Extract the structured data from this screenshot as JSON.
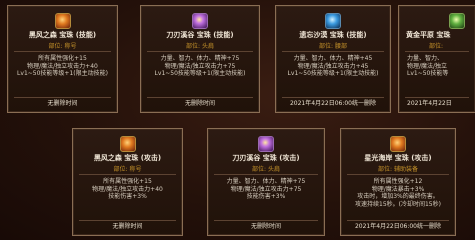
{
  "cards": [
    {
      "name": "黑风之森 宝珠 (技能)",
      "part": "部位: 称号",
      "stats": [
        "所有属性强化+15",
        "物理/魔法/独立攻击力+40",
        "Lv1~50技能等级+1(限主动技能)"
      ],
      "footer": "无删除时间"
    },
    {
      "name": "刀刃溪谷 宝珠 (技能)",
      "part": "部位: 头肩",
      "stats": [
        "力量、智力、体力、精神+75",
        "物理/魔法/独立攻击力+75",
        "Lv1~50技能等级+1(限主动技能)"
      ],
      "footer": "无删除时间"
    },
    {
      "name": "遗忘沙漠 宝珠 (技能)",
      "part": "部位: 腰部",
      "stats": [
        "力量、智力、体力、精神+45",
        "物理/魔法/独立攻击力+45",
        "Lv1~50技能等级+1(限主动技能)"
      ],
      "footer": "2021年4月22日06:00统一删除"
    },
    {
      "name": "黄金平原 宝珠",
      "part": "部位:",
      "stats": [
        "力量、智力、",
        "物理/魔法/独立",
        "Lv1~50技能等"
      ],
      "footer": "2021年4月22日"
    },
    {
      "name": "黑风之森 宝珠 (攻击)",
      "part": "部位: 称号",
      "stats": [
        "所有属性强化+15",
        "物理/魔法/独立攻击力+40",
        "技能伤害+3%"
      ],
      "footer": "无删除时间"
    },
    {
      "name": "刀刃溪谷 宝珠 (攻击)",
      "part": "部位: 头肩",
      "stats": [
        "力量、智力、体力、精神+75",
        "物理/魔法/独立攻击力+75",
        "技能伤害+3%"
      ],
      "footer": "无删除时间"
    },
    {
      "name": "星光海岸 宝珠 (攻击)",
      "part": "部位: 辅助装备",
      "stats": [
        "所有属性强化+12",
        "物理/魔法暴击+3%",
        "攻击时，增加3%的最终伤害。",
        "攻速持续15秒。(冷却时间15秒)"
      ],
      "footer": "2021年4月22日06:00统一删除"
    }
  ]
}
